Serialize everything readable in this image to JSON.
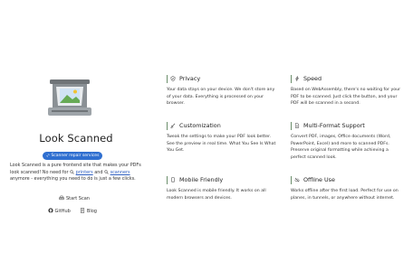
{
  "app": {
    "title": "Look Scanned",
    "badge": "Scanner repair services",
    "description_prefix": "Look Scanned is a pure frontend site that makes your PDFs look scanned! No need for ",
    "link_printers": "printers",
    "description_and": " and ",
    "link_scanners": "scanners",
    "description_suffix": " anymore - everything you need to do is just a few clicks.",
    "scan_button": "Start Scan",
    "github_link": "GitHub",
    "blog_link": "Blog"
  },
  "features": [
    {
      "icon": "shield-icon",
      "title": "Privacy",
      "body": "Your data stays on your device. We don't store any of your data. Everything is processed on your browser."
    },
    {
      "icon": "lightning-icon",
      "title": "Speed",
      "body": "Based on WebAssembly, there's no waiting for your PDF to be scanned. Just click the button, and your PDF will be scanned in a second."
    },
    {
      "icon": "brush-icon",
      "title": "Customization",
      "body": "Tweak the settings to make your PDF look better. See the preview in real time. What You See Is What You Get."
    },
    {
      "icon": "file-icon",
      "title": "Multi-Format Support",
      "body": "Convert PDF, images, Office documents (Word, PowerPoint, Excel) and more to scanned PDFs. Preserve original formatting while achieving a perfect scanned look."
    },
    {
      "icon": "phone-icon",
      "title": "Mobile Friendly",
      "body": "Look Scanned is mobile friendly. It works on all modern browsers and devices."
    },
    {
      "icon": "offline-icon",
      "title": "Offline Use",
      "body": "Works offline after the first load. Perfect for use on planes, in tunnels, or anywhere without internet."
    }
  ]
}
